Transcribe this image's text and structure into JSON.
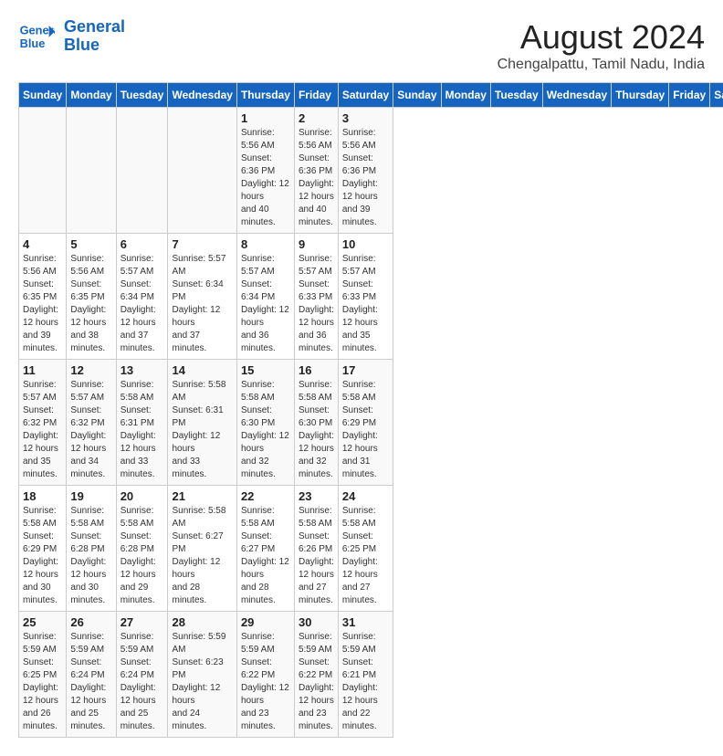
{
  "header": {
    "logo_line1": "General",
    "logo_line2": "Blue",
    "month_year": "August 2024",
    "location": "Chengalpattu, Tamil Nadu, India"
  },
  "days_of_week": [
    "Sunday",
    "Monday",
    "Tuesday",
    "Wednesday",
    "Thursday",
    "Friday",
    "Saturday"
  ],
  "weeks": [
    [
      {
        "day": "",
        "info": ""
      },
      {
        "day": "",
        "info": ""
      },
      {
        "day": "",
        "info": ""
      },
      {
        "day": "",
        "info": ""
      },
      {
        "day": "1",
        "info": "Sunrise: 5:56 AM\nSunset: 6:36 PM\nDaylight: 12 hours\nand 40 minutes."
      },
      {
        "day": "2",
        "info": "Sunrise: 5:56 AM\nSunset: 6:36 PM\nDaylight: 12 hours\nand 40 minutes."
      },
      {
        "day": "3",
        "info": "Sunrise: 5:56 AM\nSunset: 6:36 PM\nDaylight: 12 hours\nand 39 minutes."
      }
    ],
    [
      {
        "day": "4",
        "info": "Sunrise: 5:56 AM\nSunset: 6:35 PM\nDaylight: 12 hours\nand 39 minutes."
      },
      {
        "day": "5",
        "info": "Sunrise: 5:56 AM\nSunset: 6:35 PM\nDaylight: 12 hours\nand 38 minutes."
      },
      {
        "day": "6",
        "info": "Sunrise: 5:57 AM\nSunset: 6:34 PM\nDaylight: 12 hours\nand 37 minutes."
      },
      {
        "day": "7",
        "info": "Sunrise: 5:57 AM\nSunset: 6:34 PM\nDaylight: 12 hours\nand 37 minutes."
      },
      {
        "day": "8",
        "info": "Sunrise: 5:57 AM\nSunset: 6:34 PM\nDaylight: 12 hours\nand 36 minutes."
      },
      {
        "day": "9",
        "info": "Sunrise: 5:57 AM\nSunset: 6:33 PM\nDaylight: 12 hours\nand 36 minutes."
      },
      {
        "day": "10",
        "info": "Sunrise: 5:57 AM\nSunset: 6:33 PM\nDaylight: 12 hours\nand 35 minutes."
      }
    ],
    [
      {
        "day": "11",
        "info": "Sunrise: 5:57 AM\nSunset: 6:32 PM\nDaylight: 12 hours\nand 35 minutes."
      },
      {
        "day": "12",
        "info": "Sunrise: 5:57 AM\nSunset: 6:32 PM\nDaylight: 12 hours\nand 34 minutes."
      },
      {
        "day": "13",
        "info": "Sunrise: 5:58 AM\nSunset: 6:31 PM\nDaylight: 12 hours\nand 33 minutes."
      },
      {
        "day": "14",
        "info": "Sunrise: 5:58 AM\nSunset: 6:31 PM\nDaylight: 12 hours\nand 33 minutes."
      },
      {
        "day": "15",
        "info": "Sunrise: 5:58 AM\nSunset: 6:30 PM\nDaylight: 12 hours\nand 32 minutes."
      },
      {
        "day": "16",
        "info": "Sunrise: 5:58 AM\nSunset: 6:30 PM\nDaylight: 12 hours\nand 32 minutes."
      },
      {
        "day": "17",
        "info": "Sunrise: 5:58 AM\nSunset: 6:29 PM\nDaylight: 12 hours\nand 31 minutes."
      }
    ],
    [
      {
        "day": "18",
        "info": "Sunrise: 5:58 AM\nSunset: 6:29 PM\nDaylight: 12 hours\nand 30 minutes."
      },
      {
        "day": "19",
        "info": "Sunrise: 5:58 AM\nSunset: 6:28 PM\nDaylight: 12 hours\nand 30 minutes."
      },
      {
        "day": "20",
        "info": "Sunrise: 5:58 AM\nSunset: 6:28 PM\nDaylight: 12 hours\nand 29 minutes."
      },
      {
        "day": "21",
        "info": "Sunrise: 5:58 AM\nSunset: 6:27 PM\nDaylight: 12 hours\nand 28 minutes."
      },
      {
        "day": "22",
        "info": "Sunrise: 5:58 AM\nSunset: 6:27 PM\nDaylight: 12 hours\nand 28 minutes."
      },
      {
        "day": "23",
        "info": "Sunrise: 5:58 AM\nSunset: 6:26 PM\nDaylight: 12 hours\nand 27 minutes."
      },
      {
        "day": "24",
        "info": "Sunrise: 5:58 AM\nSunset: 6:25 PM\nDaylight: 12 hours\nand 27 minutes."
      }
    ],
    [
      {
        "day": "25",
        "info": "Sunrise: 5:59 AM\nSunset: 6:25 PM\nDaylight: 12 hours\nand 26 minutes."
      },
      {
        "day": "26",
        "info": "Sunrise: 5:59 AM\nSunset: 6:24 PM\nDaylight: 12 hours\nand 25 minutes."
      },
      {
        "day": "27",
        "info": "Sunrise: 5:59 AM\nSunset: 6:24 PM\nDaylight: 12 hours\nand 25 minutes."
      },
      {
        "day": "28",
        "info": "Sunrise: 5:59 AM\nSunset: 6:23 PM\nDaylight: 12 hours\nand 24 minutes."
      },
      {
        "day": "29",
        "info": "Sunrise: 5:59 AM\nSunset: 6:22 PM\nDaylight: 12 hours\nand 23 minutes."
      },
      {
        "day": "30",
        "info": "Sunrise: 5:59 AM\nSunset: 6:22 PM\nDaylight: 12 hours\nand 23 minutes."
      },
      {
        "day": "31",
        "info": "Sunrise: 5:59 AM\nSunset: 6:21 PM\nDaylight: 12 hours\nand 22 minutes."
      }
    ]
  ]
}
